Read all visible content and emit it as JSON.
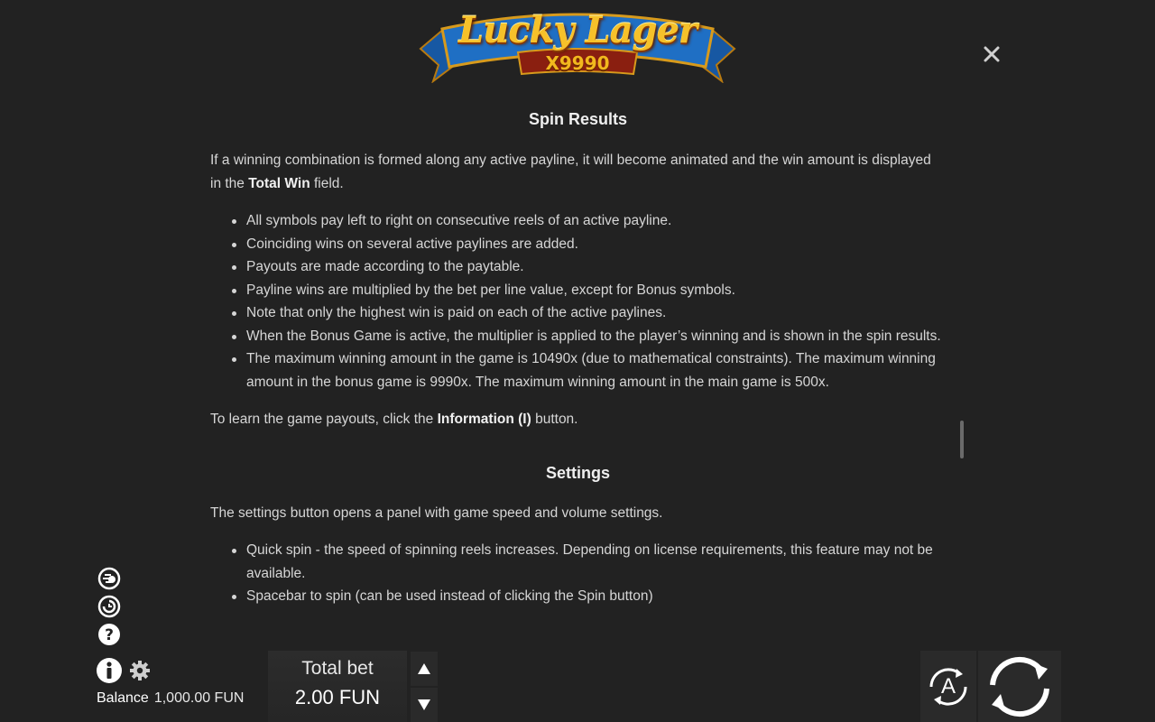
{
  "logo": {
    "title": "Lucky Lager",
    "subtitle": "X9990"
  },
  "rules": {
    "spin_results": {
      "title": "Spin Results",
      "intro_part1": "If a winning combination is formed along any active payline, it will become animated and the win amount is displayed in the ",
      "intro_bold": "Total Win",
      "intro_part2": " field.",
      "bullets": [
        "All symbols pay left to right on consecutive reels of an active payline.",
        "Coinciding wins on several active paylines are added.",
        "Payouts are made according to the paytable.",
        "Payline wins are multiplied by the bet per line value, except for Bonus symbols.",
        "Note that only the highest win is paid on each of the active paylines.",
        "When the Bonus Game is active, the multiplier is applied to the player’s winning and is shown in the spin results.",
        "The maximum winning amount in the game is 10490x (due to mathematical constraints). The maximum winning amount in the bonus game is 9990x. The maximum winning amount in the main game is 500x."
      ],
      "outro_part1": "To learn the game payouts, click the ",
      "outro_bold": "Information (I)",
      "outro_part2": " button."
    },
    "settings": {
      "title": "Settings",
      "intro": "The settings button opens a panel with game speed and volume settings.",
      "bullets": [
        "Quick spin - the speed of spinning reels increases. Depending on license requirements, this feature may not be available.",
        "Spacebar to spin (can be used instead of clicking the Spin button)"
      ]
    }
  },
  "footer": {
    "balance_label": "Balance",
    "balance_value": "1,000.00 FUN",
    "bet_label": "Total bet",
    "bet_value": "2.00 FUN",
    "auto_label": "A"
  },
  "icons": {
    "close": "close-icon",
    "turbo": "turbo-icon",
    "history": "history-icon",
    "help": "help-icon",
    "info": "info-icon",
    "settings": "gear-icon",
    "bet_up": "triangle-up-icon",
    "bet_down": "triangle-down-icon",
    "autoplay": "autoplay-icon",
    "spin": "spin-icon"
  },
  "colors": {
    "background": "#222222",
    "text": "#d6d6d6",
    "logo_gold": "#f6c12a",
    "logo_ribbon": "#1f6fc4"
  }
}
